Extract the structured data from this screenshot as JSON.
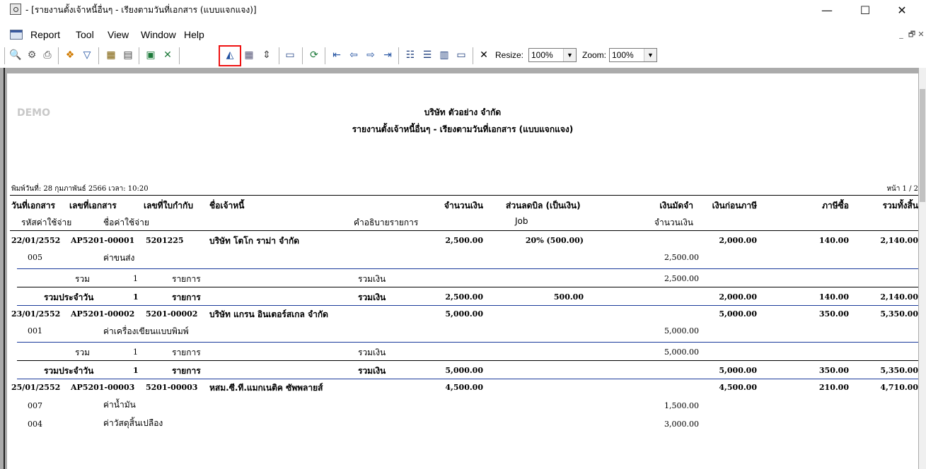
{
  "window": {
    "title": " - [รายงานตั้งเจ้าหนี้อื่นๆ - เรียงตามวันที่เอกสาร (แบบแจกแจง)]",
    "minimize": "—",
    "maximize": "☐",
    "close": "✕"
  },
  "menu": {
    "items": [
      "Report",
      "Tool",
      "View",
      "Window",
      "Help"
    ],
    "mdi_min": "_",
    "mdi_restore": "🗗",
    "mdi_close": "✕"
  },
  "toolbar": {
    "resize_label": "Resize:",
    "resize_value": "100%",
    "zoom_label": "Zoom:",
    "zoom_value": "100%",
    "icons": [
      "preview-icon",
      "setup-icon",
      "print-icon",
      "group-icon",
      "filter-icon",
      "design-icon",
      "export-icon",
      "excel-icon",
      "excel-x-icon",
      "edit-report-icon",
      "grid-icon",
      "fit-icon",
      "calculator-icon",
      "refresh-icon",
      "first-page-icon",
      "prev-page-icon",
      "next-page-icon",
      "last-page-icon",
      "tree-icon",
      "list-icon",
      "columns-icon",
      "window-icon",
      "close-report-icon"
    ],
    "highlight_color": "#e11111"
  },
  "report": {
    "watermark": "DEMO",
    "company": "บริษัท ตัวอย่าง จำกัด",
    "report_title": "รายงานตั้งเจ้าหนี้อื่นๆ - เรียงตามวันที่เอกสาร (แบบแจกแจง)",
    "print_info": "พิมพ์วันที่: 28 กุมภาพันธ์ 2566  เวลา: 10:20",
    "page_info": "หน้า 1 / 2",
    "columns_row1": {
      "doc_date": "วันที่เอกสาร",
      "doc_no": "เลขที่เอกสาร",
      "invoice_no": "เลขที่ใบกำกับ",
      "creditor": "ชื่อเจ้าหนี้",
      "amount": "จำนวนเงิน",
      "discount": "ส่วนลดบิล (เป็นเงิน)",
      "deposit": "เงินมัดจำ",
      "before_tax": "เงินก่อนภาษี",
      "tax": "ภาษีซื้อ",
      "total": "รวมทั้งสิ้น"
    },
    "columns_row2": {
      "exp_code": "รหัสค่าใช้จ่าย",
      "exp_name": "ชื่อค่าใช้จ่าย",
      "desc": "คำอธิบายรายการ",
      "job": "Job",
      "amount": "จำนวนเงิน"
    },
    "labels": {
      "sum": "รวม",
      "daily_sum": "รวมประจำวัน",
      "items": "รายการ",
      "sum_amount": "รวมเงิน"
    },
    "docs": [
      {
        "date": "22/01/2552",
        "doc_no": "AP5201-00001",
        "invoice": "5201225",
        "creditor": "บริษัท โตโก ราม่า จำกัด",
        "amount": "2,500.00",
        "discount": "20% (500.00)",
        "before_tax": "2,000.00",
        "tax": "140.00",
        "total": "2,140.00",
        "lines": [
          {
            "code": "005",
            "name": "ค่าขนส่ง",
            "amount": "2,500.00"
          }
        ],
        "sum_count": "1",
        "sum_amount": "2,500.00",
        "day_count": "1",
        "day_amount": "2,500.00",
        "day_discount": "500.00",
        "day_before_tax": "2,000.00",
        "day_tax": "140.00",
        "day_total": "2,140.00"
      },
      {
        "date": "23/01/2552",
        "doc_no": "AP5201-00002",
        "invoice": "5201-00002",
        "creditor": "บริษัท แกรน อินเตอร์สเกล จำกัด",
        "amount": "5,000.00",
        "discount": "",
        "before_tax": "5,000.00",
        "tax": "350.00",
        "total": "5,350.00",
        "lines": [
          {
            "code": "001",
            "name": "ค่าเครื่องเขียนแบบพิมพ์",
            "amount": "5,000.00"
          }
        ],
        "sum_count": "1",
        "sum_amount": "5,000.00",
        "day_count": "1",
        "day_amount": "5,000.00",
        "day_discount": "",
        "day_before_tax": "5,000.00",
        "day_tax": "350.00",
        "day_total": "5,350.00"
      },
      {
        "date": "25/01/2552",
        "doc_no": "AP5201-00003",
        "invoice": "5201-00003",
        "creditor": "หสม.ซี.ที.แมกเนติค ซัพพลายส์",
        "amount": "4,500.00",
        "discount": "",
        "before_tax": "4,500.00",
        "tax": "210.00",
        "total": "4,710.00",
        "lines": [
          {
            "code": "007",
            "name": "ค่าน้ำมัน",
            "amount": "1,500.00"
          },
          {
            "code": "004",
            "name": "ค่าวัสดุสิ้นเปลือง",
            "amount": "3,000.00"
          }
        ]
      }
    ]
  }
}
